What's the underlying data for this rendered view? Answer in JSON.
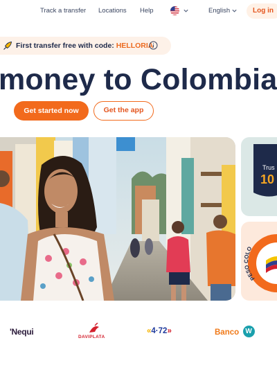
{
  "nav": {
    "track_label": "Track a transfer",
    "locations_label": "Locations",
    "help_label": "Help",
    "country_flag_icon": "us-flag-icon",
    "language_label": "English",
    "login_label": "Log in"
  },
  "promo": {
    "prefix": "First transfer free with code: ",
    "code": "HELLORIA",
    "icon": "rocket-icon",
    "info_icon": "info-icon"
  },
  "hero": {
    "headline": "money to Colombia",
    "primary_cta": "Get started now",
    "secondary_cta": "Get the app"
  },
  "cards": {
    "trust_text": "Trus",
    "trust_number": "10",
    "peso_badge_text": "PESO COLO"
  },
  "partners": {
    "nequi": "'Nequi",
    "daviplata": "DAVIPLATA",
    "four72_left": "«",
    "four72_main": "4·72",
    "four72_right": "»",
    "banco": "Banco",
    "banco_mark": "W"
  },
  "colors": {
    "accent": "#f26a1c",
    "navy": "#1e2a4a",
    "promo_bg": "#fdf1e8",
    "trust_bg": "#dbe8e6",
    "peso_bg": "#fde9dc"
  }
}
